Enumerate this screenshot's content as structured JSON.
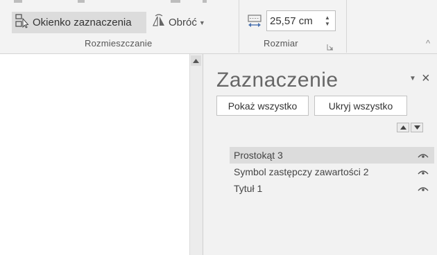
{
  "ribbon": {
    "okienko_label": "Okienko zaznaczenia",
    "obroc_label": "Obróć",
    "group_rozmieszczanie": "Rozmieszczanie",
    "group_rozmiar": "Rozmiar",
    "size_value": "25,57 cm"
  },
  "pane": {
    "title": "Zaznaczenie",
    "show_all_label": "Pokaż wszystko",
    "hide_all_label": "Ukryj wszystko",
    "items": [
      {
        "name": "Prostokąt 3",
        "selected": true
      },
      {
        "name": "Symbol zastępczy zawartości 2",
        "selected": false
      },
      {
        "name": "Tytuł 1",
        "selected": false
      }
    ]
  },
  "icons": {
    "selection_pane": "selection-pane-icon",
    "rotate": "rotate-icon",
    "width": "width-icon",
    "eye": "eye-icon",
    "close": "close-icon",
    "menu": "chevron-down-icon"
  },
  "colors": {
    "ribbon_bg": "#f3f3f3",
    "pane_bg": "#f2f2f2",
    "selected_bg": "#dcdcdc"
  }
}
